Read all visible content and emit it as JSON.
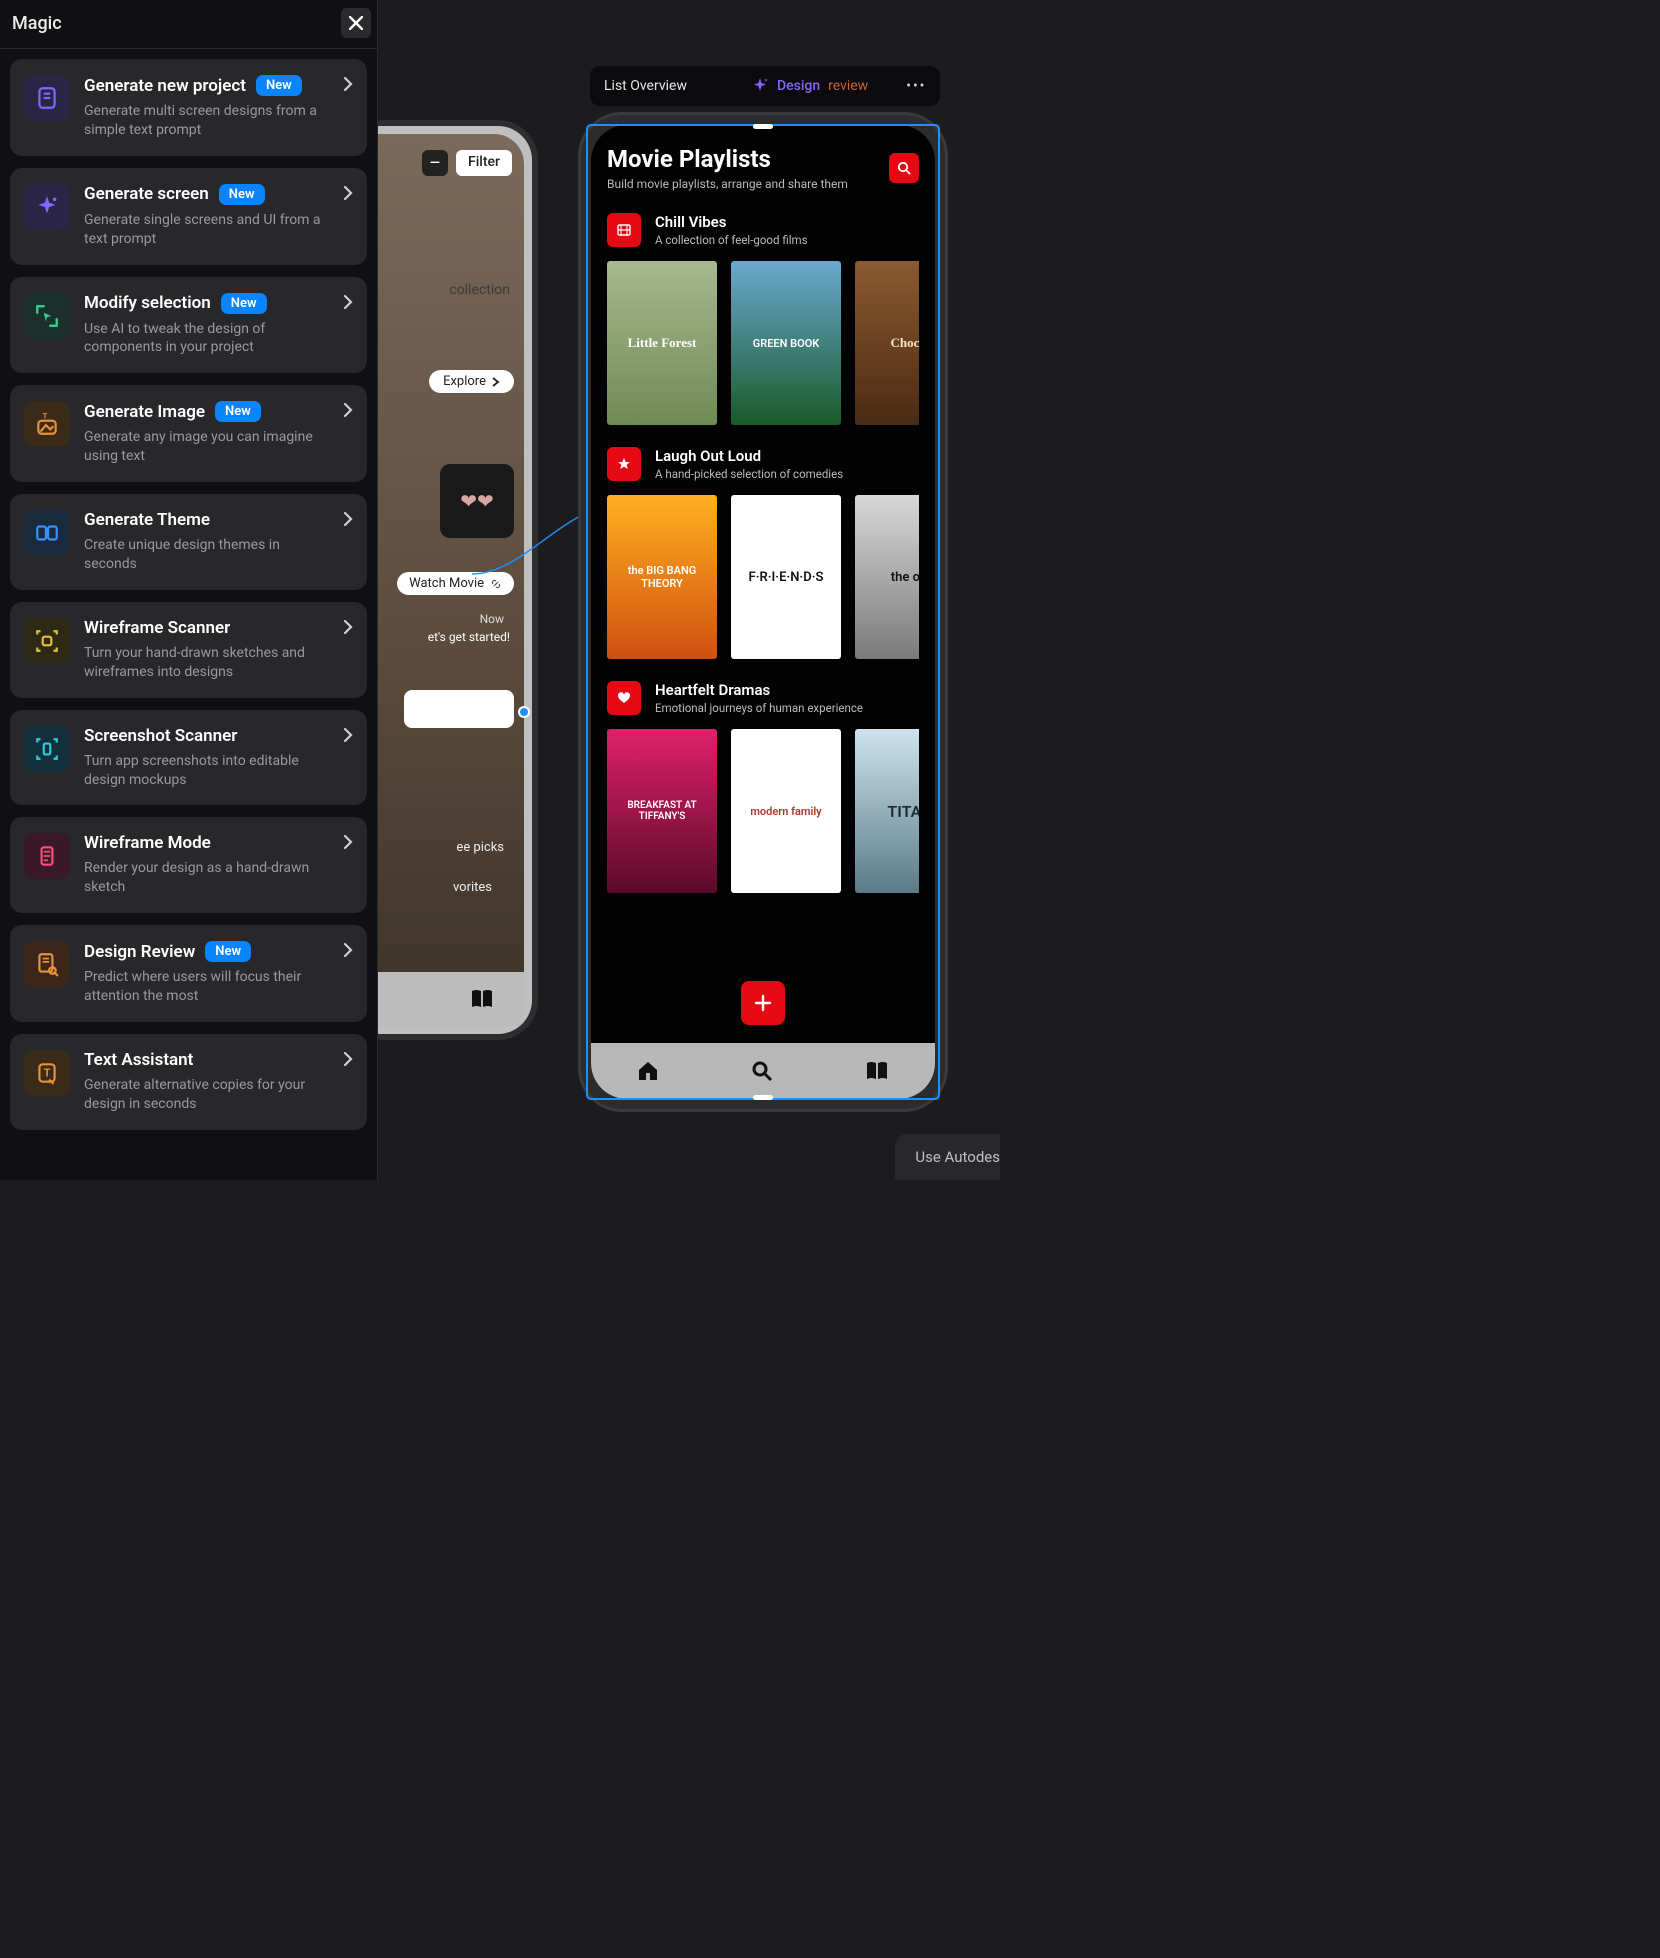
{
  "panel": {
    "title": "Magic",
    "new_badge": "New",
    "items": [
      {
        "title": "Generate new project",
        "new": true,
        "desc": "Generate multi screen designs from a simple text prompt"
      },
      {
        "title": "Generate screen",
        "new": true,
        "desc": "Generate single screens and UI from a text prompt"
      },
      {
        "title": "Modify selection",
        "new": true,
        "desc": "Use AI to tweak the design of components in your project"
      },
      {
        "title": "Generate Image",
        "new": true,
        "desc": "Generate any image you can imagine using text"
      },
      {
        "title": "Generate Theme",
        "new": false,
        "desc": "Create unique design themes in seconds"
      },
      {
        "title": "Wireframe Scanner",
        "new": false,
        "desc": "Turn your hand-drawn sketches and wireframes into designs"
      },
      {
        "title": "Screenshot Scanner",
        "new": false,
        "desc": "Turn app screenshots into editable design mockups"
      },
      {
        "title": "Wireframe Mode",
        "new": false,
        "desc": "Render your design as a hand-drawn sketch"
      },
      {
        "title": "Design Review",
        "new": true,
        "desc": "Predict where users will focus their attention the most"
      },
      {
        "title": "Text Assistant",
        "new": false,
        "desc": "Generate alternative copies for your design in seconds"
      }
    ]
  },
  "context_bar": {
    "title": "List Overview",
    "review_label": "Design",
    "review_sub": "review"
  },
  "partial_phone": {
    "filter": "Filter",
    "collection": "collection",
    "explore": "Explore",
    "watch": "Watch Movie",
    "now": "Now",
    "started": "et's get started!",
    "picks": "ee picks",
    "favorites": "vorites"
  },
  "phone": {
    "title": "Movie Playlists",
    "subtitle": "Build movie playlists, arrange and share them",
    "playlists": [
      {
        "title": "Chill Vibes",
        "desc": "A collection of feel-good films",
        "posters": [
          "Little Forest",
          "GREEN BOOK",
          "Chocol"
        ]
      },
      {
        "title": "Laugh Out Loud",
        "desc": "A hand-picked selection of comedies",
        "posters": [
          "the BIG BANG THEORY",
          "F·R·I·E·N·D·S",
          "the off"
        ]
      },
      {
        "title": "Heartfelt Dramas",
        "desc": "Emotional journeys of human experience",
        "posters": [
          "BREAKFAST AT TIFFANY'S",
          "modern family",
          "TITAN"
        ]
      }
    ]
  },
  "footer": {
    "autodesigner": "Use Autodes"
  }
}
